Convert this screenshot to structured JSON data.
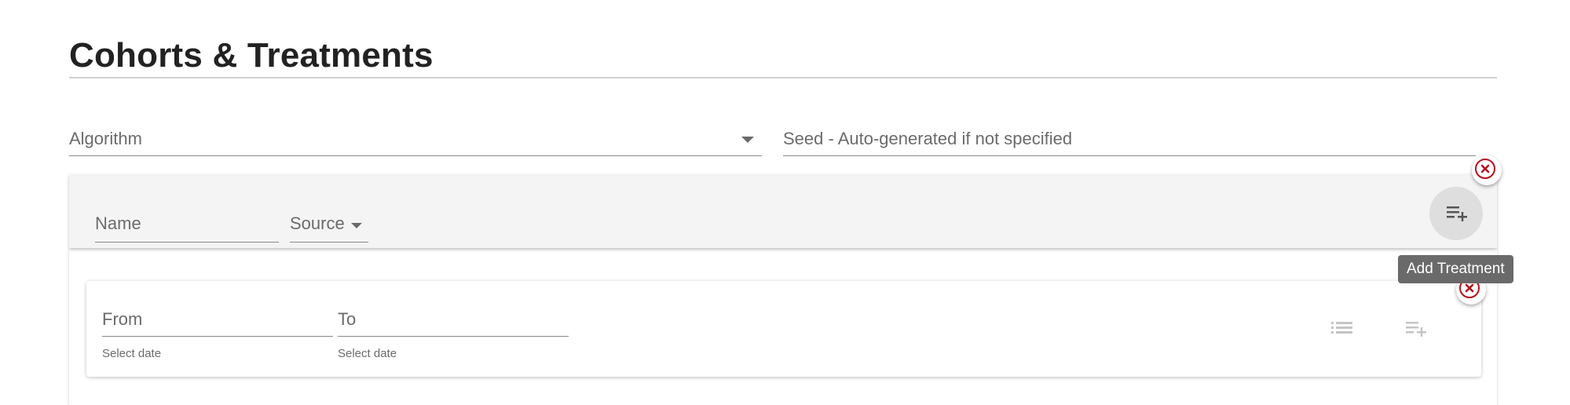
{
  "header": {
    "title": "Cohorts & Treatments"
  },
  "algorithm": {
    "label": "Algorithm"
  },
  "seed": {
    "label": "Seed - Auto-generated if not specified"
  },
  "cohort": {
    "name_label": "Name",
    "source_label": "Source",
    "add_treatment_tooltip": "Add Treatment"
  },
  "treatment": {
    "from_label": "From",
    "from_hint": "Select date",
    "to_label": "To",
    "to_hint": "Select date"
  },
  "icons": {
    "add": "playlist-add-icon",
    "list": "list-icon",
    "close": "close-circle-icon",
    "dropdown": "caret-down-icon"
  },
  "colors": {
    "close_accent": "#b3121d",
    "tooltip_bg": "#6a6a6a",
    "card_bg": "#f4f4f4"
  }
}
